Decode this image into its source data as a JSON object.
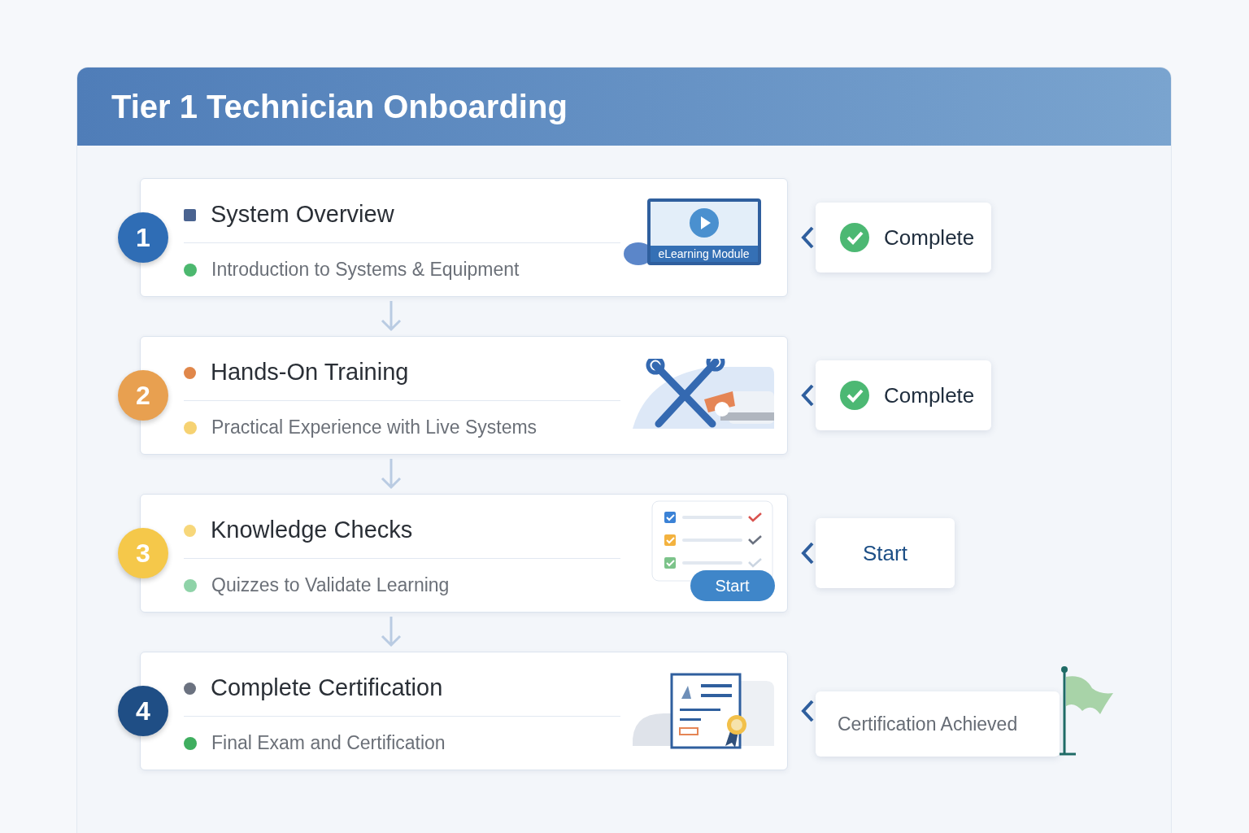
{
  "title": "Tier 1 Technician Onboarding",
  "steps": [
    {
      "number": "1",
      "color": "#2f6db5",
      "marker": {
        "kind": "square",
        "color": "#4a6390"
      },
      "title": "System Overview",
      "bullet": {
        "color": "#4cb86f"
      },
      "subtitle": "Introduction to Systems & Equipment",
      "illustration": {
        "kind": "elearning",
        "label": "eLearning Module"
      },
      "status": {
        "kind": "complete",
        "label": "Complete"
      }
    },
    {
      "number": "2",
      "color": "#e8a050",
      "marker": {
        "kind": "circle",
        "color": "#e0874a"
      },
      "title": "Hands-On Training",
      "bullet": {
        "color": "#f6d272"
      },
      "subtitle": "Practical Experience with Live Systems",
      "illustration": {
        "kind": "tools"
      },
      "status": {
        "kind": "complete",
        "label": "Complete"
      }
    },
    {
      "number": "3",
      "color": "#f5c84a",
      "marker": {
        "kind": "circle",
        "color": "#f7d77a"
      },
      "title": "Knowledge Checks",
      "bullet": {
        "color": "#8fd3a8"
      },
      "subtitle": "Quizzes to Validate Learning",
      "illustration": {
        "kind": "quiz",
        "button": "Start"
      },
      "status": {
        "kind": "start",
        "label": "Start"
      }
    },
    {
      "number": "4",
      "color": "#1f4e85",
      "marker": {
        "kind": "circle",
        "color": "#6b7280"
      },
      "title": "Complete Certification",
      "bullet": {
        "color": "#3fae5f"
      },
      "subtitle": "Final Exam and Certification",
      "illustration": {
        "kind": "certificate"
      },
      "status": {
        "kind": "achieved",
        "label": "Certification Achieved"
      }
    }
  ]
}
